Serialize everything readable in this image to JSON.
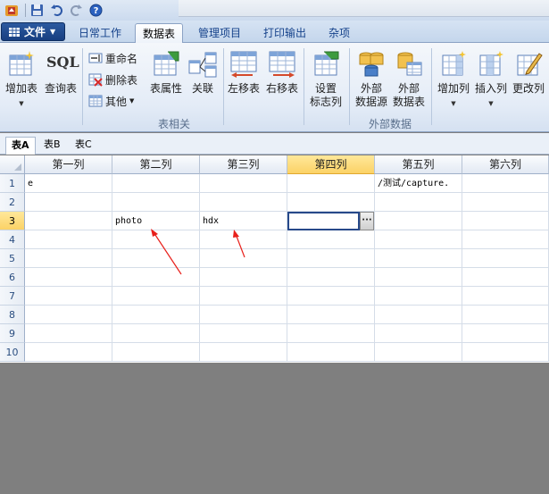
{
  "quick_access": {
    "icons": [
      "app-logo-icon",
      "save-icon",
      "undo-icon",
      "redo-icon",
      "help-icon"
    ]
  },
  "tabs": {
    "file_label": "文件",
    "items": [
      {
        "label": "日常工作",
        "active": false
      },
      {
        "label": "数据表",
        "active": true
      },
      {
        "label": "管理项目",
        "active": false
      },
      {
        "label": "打印输出",
        "active": false
      },
      {
        "label": "杂项",
        "active": false
      }
    ]
  },
  "ribbon": {
    "add_table": "增加表",
    "query_table": "查询表",
    "sql_icon_text": "SQL",
    "rename": "重命名",
    "delete_table": "删除表",
    "other": "其他",
    "table_props": "表属性",
    "relation": "关联",
    "group_table": "表相关",
    "move_left": "左移表",
    "move_right": "右移表",
    "set_marker_l1": "设置",
    "set_marker_l2": "标志列",
    "ext_source_l1": "外部",
    "ext_source_l2": "数据源",
    "ext_table_l1": "外部",
    "ext_table_l2": "数据表",
    "group_external": "外部数据",
    "add_col": "增加列",
    "insert_col": "插入列",
    "change_col": "更改列"
  },
  "sheet_tabs": [
    {
      "label": "表A",
      "active": true
    },
    {
      "label": "表B",
      "active": false
    },
    {
      "label": "表C",
      "active": false
    }
  ],
  "grid": {
    "columns": [
      "第一列",
      "第二列",
      "第三列",
      "第四列",
      "第五列",
      "第六列"
    ],
    "selected_column": 3,
    "selected_row": 3,
    "rows": [
      "1",
      "2",
      "3",
      "4",
      "5",
      "6",
      "7",
      "8",
      "9",
      "10"
    ],
    "cells": {
      "r1c1": "e",
      "r1c5": "/测试/capture.",
      "r3c2": "photo",
      "r3c3": "hdx"
    },
    "edit_button": "···"
  },
  "annotation_color": "#e8201b"
}
